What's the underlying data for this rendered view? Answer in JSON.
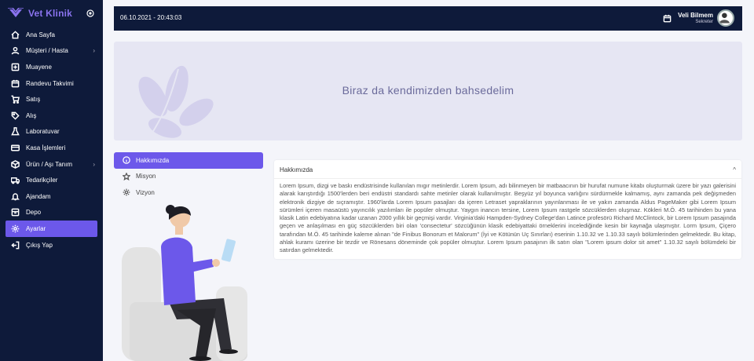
{
  "brand": {
    "name": "Vet Klinik",
    "color": "#8a73ef"
  },
  "sidebar": {
    "items": [
      {
        "label": "Ana Sayfa",
        "icon": "home-icon"
      },
      {
        "label": "Müşteri / Hasta",
        "icon": "user-icon",
        "has_submenu": true
      },
      {
        "label": "Muayene",
        "icon": "plus-square-icon"
      },
      {
        "label": "Randevu Takvimi",
        "icon": "calendar-icon"
      },
      {
        "label": "Satış",
        "icon": "cart-icon"
      },
      {
        "label": "Alış",
        "icon": "tag-icon"
      },
      {
        "label": "Laboratuvar",
        "icon": "flask-icon"
      },
      {
        "label": "Kasa İşlemleri",
        "icon": "credit-card-icon"
      },
      {
        "label": "Ürün / Aşı Tanım",
        "icon": "box-icon",
        "has_submenu": true
      },
      {
        "label": "Tedarikçiler",
        "icon": "truck-icon"
      },
      {
        "label": "Ajandam",
        "icon": "bell-icon"
      },
      {
        "label": "Depo",
        "icon": "archive-icon"
      },
      {
        "label": "Ayarlar",
        "icon": "gear-icon",
        "active": true
      },
      {
        "label": "Çıkış Yap",
        "icon": "logout-icon"
      }
    ]
  },
  "header": {
    "datetime": "06.10.2021 - 20:43:03",
    "user_name": "Veli Bilmem",
    "user_role": "Sekreter"
  },
  "hero": {
    "title": "Biraz da kendimizden bahsedelim"
  },
  "tabs": [
    {
      "label": "Hakkımızda",
      "icon": "info-icon",
      "active": true
    },
    {
      "label": "Misyon",
      "icon": "star-icon"
    },
    {
      "label": "Vizyon",
      "icon": "sun-icon"
    }
  ],
  "card": {
    "title": "Hakkımızda",
    "body": "Lorem Ipsum, dizgi ve baskı endüstrisinde kullanılan mıgır metinlerdir. Lorem Ipsum, adı bilinmeyen bir matbaacının bir hurufat numune kitabı oluşturmak üzere bir yazı galerisini alarak karıştırdığı 1500'lerden beri endüstri standardı sahte metinler olarak kullanılmıştır. Beşyüz yıl boyunca varlığını sürdürmekle kalmamış, aynı zamanda pek değişmeden elektronik dizgiye de sıçramıştır. 1960'larda Lorem Ipsum pasajları da içeren Letraset yapraklarının yayınlanması ile ve yakın zamanda Aldus PageMaker gibi Lorem Ipsum sürümleri içeren masaüstü yayıncılık yazılımları ile popüler olmuştur. Yaygın inancın tersine, Lorem Ipsum rastgele sözcüklerden oluşmaz. Kökleri M.Ö. 45 tarihinden bu yana klasik Latin edebiyatına kadar uzanan 2000 yıllık bir geçmişi vardır. Virginia'daki Hampden-Sydney College'dan Latince profesörü Richard McClintock, bir Lorem Ipsum pasajında geçen ve anlaşılması en güç sözcüklerden biri olan 'consectetur' sözcüğünün klasik edebiyattaki örneklerini incelediğinde kesin bir kaynağa ulaşmıştır. Lorm Ipsum, Çiçero tarafından M.Ö. 45 tarihinde kaleme alınan \"de Finibus Bonorum et Malorum\" (İyi ve Kötünün Uç Sınırları) eserinin 1.10.32 ve 1.10.33 sayılı bölümlerinden gelmektedir. Bu kitap, ahlak kuramı üzerine bir tezdir ve Rönesans döneminde çok popüler olmuştur. Lorem Ipsum pasajının ilk satırı olan \"Lorem ipsum dolor sit amet\" 1.10.32 sayılı bölümdeki bir satırdan gelmektedir."
  },
  "colors": {
    "sidebar_bg": "#0e1a3a",
    "accent": "#6c58ea",
    "hero_bg": "#e6e6f3"
  }
}
